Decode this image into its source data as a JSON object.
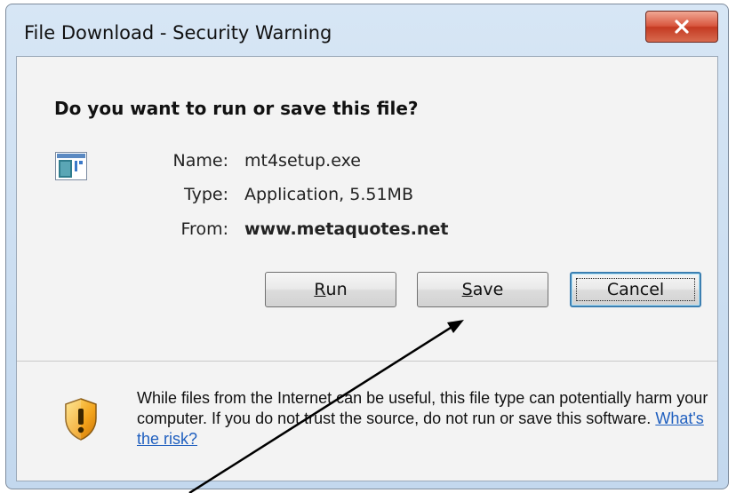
{
  "window": {
    "title": "File Download - Security Warning",
    "close_icon": "close-x-icon"
  },
  "dialog": {
    "heading": "Do you want to run or save this file?",
    "file_icon": "application-window-icon",
    "fields": [
      {
        "label": "Name:",
        "value": "mt4setup.exe",
        "bold": false
      },
      {
        "label": "Type:",
        "value": "Application, 5.51MB",
        "bold": false
      },
      {
        "label": "From:",
        "value": "www.metaquotes.net",
        "bold": true
      }
    ]
  },
  "buttons": {
    "run": {
      "mnemonic": "R",
      "rest": "un"
    },
    "save": {
      "mnemonic": "S",
      "rest": "ave"
    },
    "cancel": "Cancel"
  },
  "warning": {
    "icon": "security-shield-warning-icon",
    "text": "While files from the Internet can be useful, this file type can potentially harm your computer. If you do not trust the source, do not run or save this software.",
    "link": "What's the risk?"
  },
  "annotation": {
    "arrow_target": "save-button",
    "color": "#000000"
  }
}
